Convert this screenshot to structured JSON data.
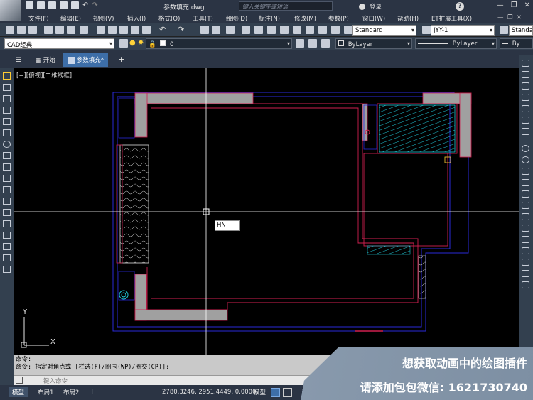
{
  "titlebar": {
    "doc_title": "参数填充.dwg",
    "search_placeholder": "键入关键字或短语",
    "login": "登录",
    "help": "?"
  },
  "menu": [
    "文件(F)",
    "编辑(E)",
    "视图(V)",
    "插入(I)",
    "格式(O)",
    "工具(T)",
    "绘图(D)",
    "标注(N)",
    "修改(M)",
    "参数(P)",
    "窗口(W)",
    "帮助(H)",
    "ET扩展工具(X)"
  ],
  "toolbar1": {
    "text_style": "Standard",
    "dim_style": "JYY-1",
    "table_style": "Standa"
  },
  "toolbar2": {
    "workspace": "CAD经典",
    "layer": "0",
    "color": "ByLayer",
    "linetype": "ByLayer",
    "lineweight": "By"
  },
  "tabs": [
    {
      "label": "开始"
    },
    {
      "label": "参数填充*"
    }
  ],
  "add_tab": "+",
  "viewport_label": "[−][俯视][二维线框]",
  "dynamic_input": "HN",
  "ucs": {
    "x": "X",
    "y": "Y"
  },
  "command_history": [
    "命令:",
    "命令: 指定对角点或 [栏选(F)/圈围(WP)/圈交(CP)]:"
  ],
  "command_placeholder": "键入命令",
  "layouts": [
    "模型",
    "布局1",
    "布局2"
  ],
  "layout_add": "+",
  "coordinates": "2780.3246, 2951.4449, 0.0000",
  "status_model": "模型",
  "promo": {
    "line1": "想获取动画中的绘图插件",
    "line2": "请添加包包微信: 1621730740"
  },
  "colors": {
    "titlebar": "#2b3444",
    "toolbar": "#33404f",
    "canvas": "#000000",
    "wall_fill": "#a0a0a0",
    "outline_blue": "#2a2ad8",
    "outline_red": "#d02050",
    "hatch_cyan": "#20c8d8",
    "active_tab": "#3d6ea8"
  }
}
